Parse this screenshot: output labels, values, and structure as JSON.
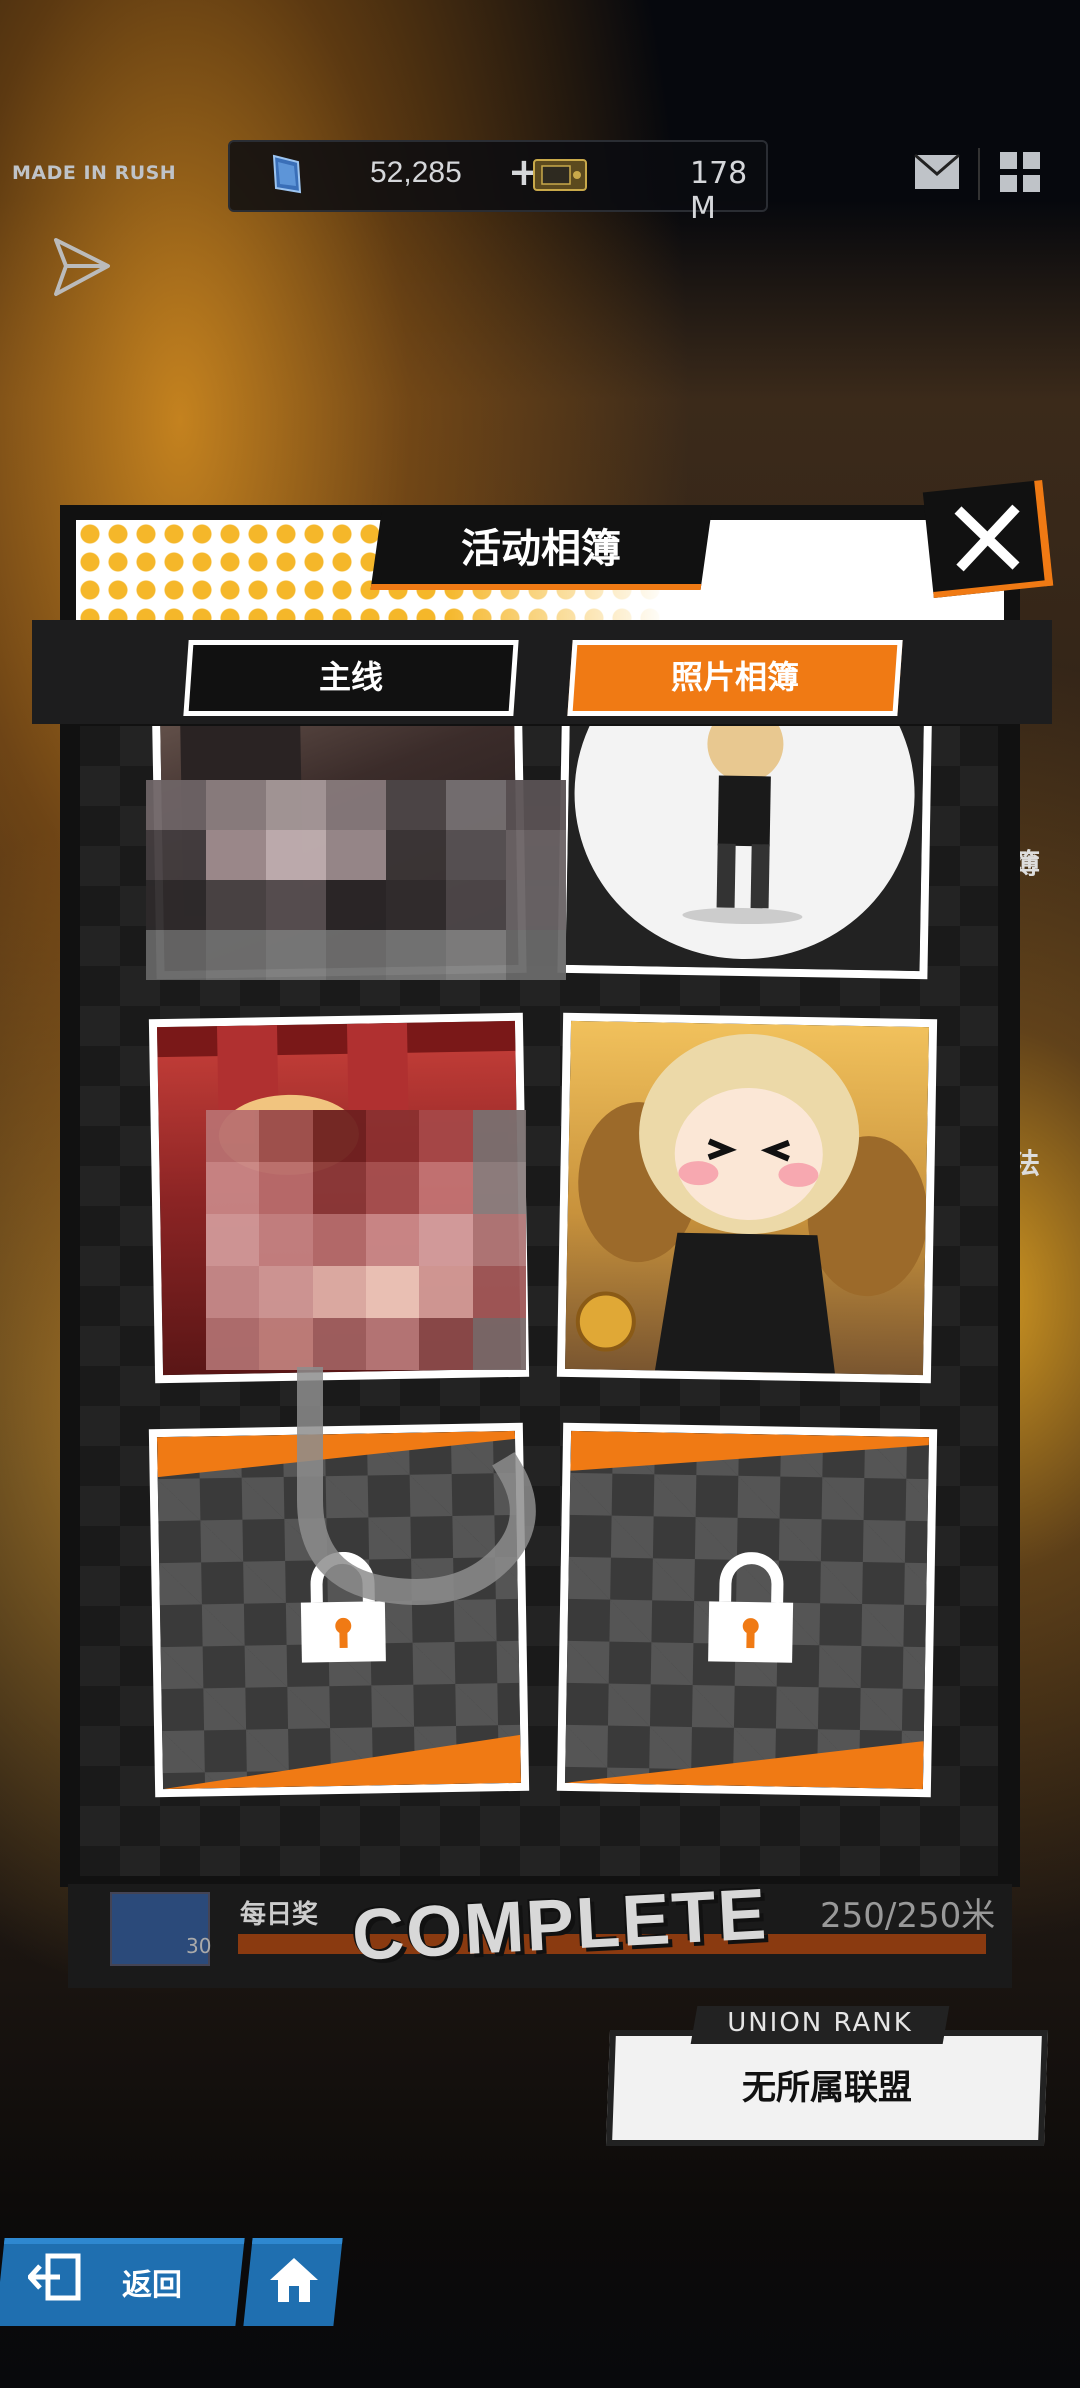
{
  "topbar": {
    "brand": "MADE IN RUSH",
    "gems": "52,285",
    "gems_plus": "+",
    "credits": "178 M"
  },
  "modal": {
    "title": "活动相簿",
    "tabs": [
      {
        "label": "主线",
        "active": false
      },
      {
        "label": "照片相簿",
        "active": true
      }
    ],
    "photos": [
      {
        "state": "unlocked-censored"
      },
      {
        "state": "unlocked"
      },
      {
        "state": "unlocked-censored"
      },
      {
        "state": "unlocked"
      },
      {
        "state": "locked"
      },
      {
        "state": "locked"
      }
    ]
  },
  "side_text": [
    "簿",
    "法"
  ],
  "progress": {
    "label": "每日奖",
    "count": "30",
    "value": "250/250米",
    "fraction": 1.0,
    "stamp": "COMPLETE"
  },
  "union": {
    "tag": "UNION RANK",
    "name": "无所属联盟"
  },
  "nav": {
    "back_label": "返回"
  },
  "colors": {
    "accent": "#f07a14",
    "nav_blue": "#1f6fb0"
  }
}
